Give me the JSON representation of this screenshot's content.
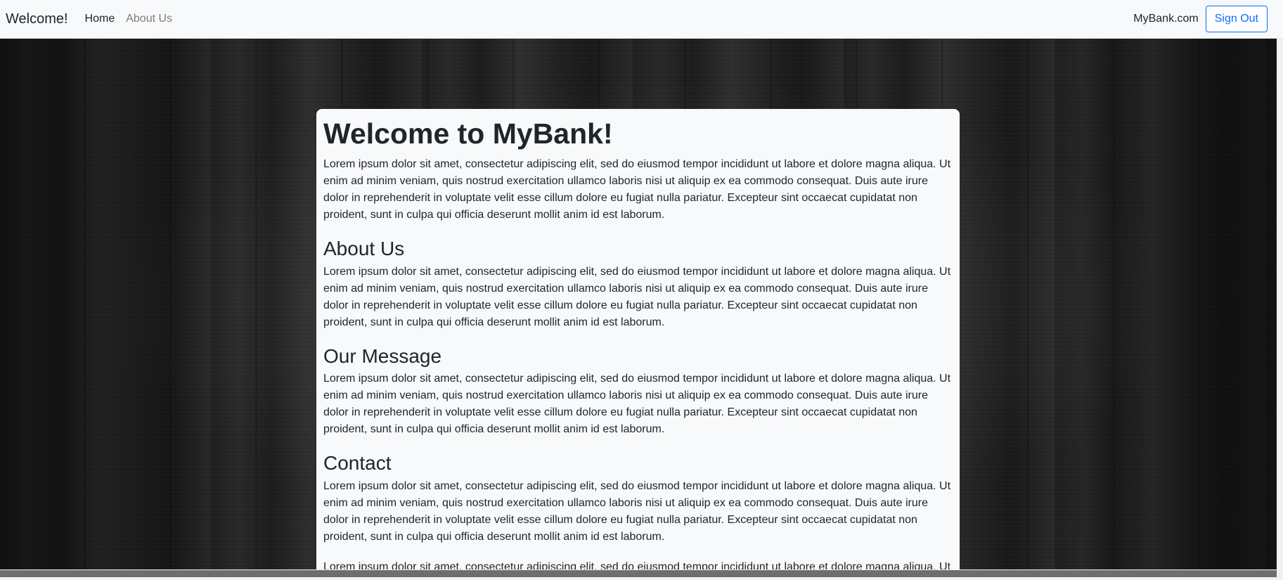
{
  "navbar": {
    "brand": "Welcome!",
    "links": [
      {
        "label": "Home"
      },
      {
        "label": "About Us"
      }
    ],
    "site_label": "MyBank.com",
    "signout_label": "Sign Out"
  },
  "content": {
    "title": "Welcome to MyBank!",
    "intro": "Lorem ipsum dolor sit amet, consectetur adipiscing elit, sed do eiusmod tempor incididunt ut labore et dolore magna aliqua. Ut enim ad minim veniam, quis nostrud exercitation ullamco laboris nisi ut aliquip ex ea commodo consequat. Duis aute irure dolor in reprehenderit in voluptate velit esse cillum dolore eu fugiat nulla pariatur. Excepteur sint occaecat cupidatat non proident, sunt in culpa qui officia deserunt mollit anim id est laborum.",
    "sections": [
      {
        "heading": "About Us",
        "text": "Lorem ipsum dolor sit amet, consectetur adipiscing elit, sed do eiusmod tempor incididunt ut labore et dolore magna aliqua. Ut enim ad minim veniam, quis nostrud exercitation ullamco laboris nisi ut aliquip ex ea commodo consequat. Duis aute irure dolor in reprehenderit in voluptate velit esse cillum dolore eu fugiat nulla pariatur. Excepteur sint occaecat cupidatat non proident, sunt in culpa qui officia deserunt mollit anim id est laborum."
      },
      {
        "heading": "Our Message",
        "text": "Lorem ipsum dolor sit amet, consectetur adipiscing elit, sed do eiusmod tempor incididunt ut labore et dolore magna aliqua. Ut enim ad minim veniam, quis nostrud exercitation ullamco laboris nisi ut aliquip ex ea commodo consequat. Duis aute irure dolor in reprehenderit in voluptate velit esse cillum dolore eu fugiat nulla pariatur. Excepteur sint occaecat cupidatat non proident, sunt in culpa qui officia deserunt mollit anim id est laborum."
      },
      {
        "heading": "Contact",
        "text": "Lorem ipsum dolor sit amet, consectetur adipiscing elit, sed do eiusmod tempor incididunt ut labore et dolore magna aliqua. Ut enim ad minim veniam, quis nostrud exercitation ullamco laboris nisi ut aliquip ex ea commodo consequat. Duis aute irure dolor in reprehenderit in voluptate velit esse cillum dolore eu fugiat nulla pariatur. Excepteur sint occaecat cupidatat non proident, sunt in culpa qui officia deserunt mollit anim id est laborum."
      }
    ],
    "trailing_text": "Lorem ipsum dolor sit amet, consectetur adipiscing elit, sed do eiusmod tempor incididunt ut labore et dolore magna aliqua. Ut enim ad minim veniam, quis nostrud exercitation ullamco laboris nisi ut aliquip ex ea commodo consequat."
  },
  "colors": {
    "navbar_bg": "#f8f9fa",
    "primary": "#0d6efd",
    "text": "#212529",
    "muted_link": "#7b7b7b",
    "card_bg": "#f8f9fa"
  }
}
